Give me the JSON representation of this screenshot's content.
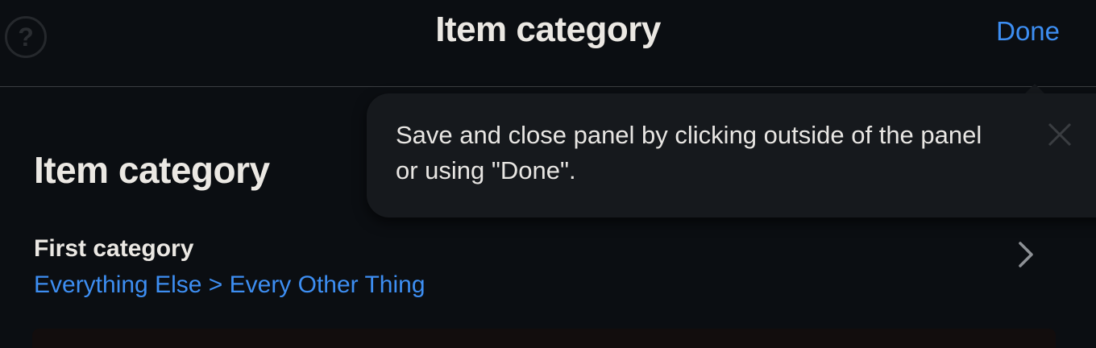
{
  "header": {
    "help_icon_glyph": "?",
    "title": "Item category",
    "done_label": "Done"
  },
  "section": {
    "title": "Item category",
    "first_category": {
      "label": "First category",
      "value": "Everything Else > Every Other Thing"
    }
  },
  "tooltip": {
    "message": "Save and close panel by clicking outside of the panel or using \"Done\"."
  },
  "colors": {
    "background": "#0b0e12",
    "accent": "#3d8ef2",
    "text": "#ebe8e3",
    "tooltip_bg": "#16191d"
  },
  "icons": {
    "help": "question-circle-icon",
    "chevron": "chevron-right-icon",
    "close": "close-icon"
  }
}
